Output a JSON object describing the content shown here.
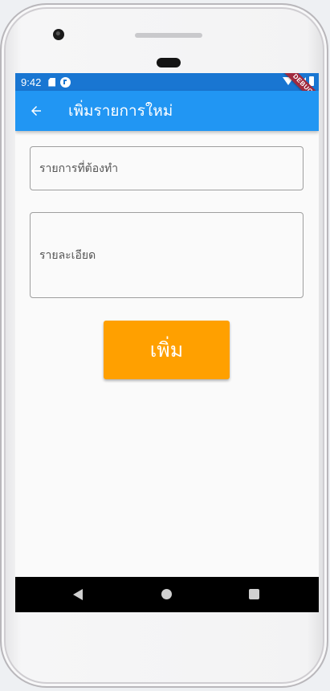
{
  "status_bar": {
    "time": "9:42",
    "debug_banner": "DEBUG"
  },
  "app_bar": {
    "title": "เพิ่มรายการใหม่",
    "back_icon": "arrow-back-icon"
  },
  "form": {
    "title_placeholder": "รายการที่ต้องทำ",
    "detail_placeholder": "รายละเอียด",
    "submit_label": "เพิ่ม"
  },
  "colors": {
    "status_bar": "#1976d2",
    "app_bar": "#2196f3",
    "button": "#ffa000",
    "nav_bar": "#000000"
  },
  "nav_bar": {
    "icons": [
      "nav-back-icon",
      "nav-home-icon",
      "nav-recents-icon"
    ]
  }
}
